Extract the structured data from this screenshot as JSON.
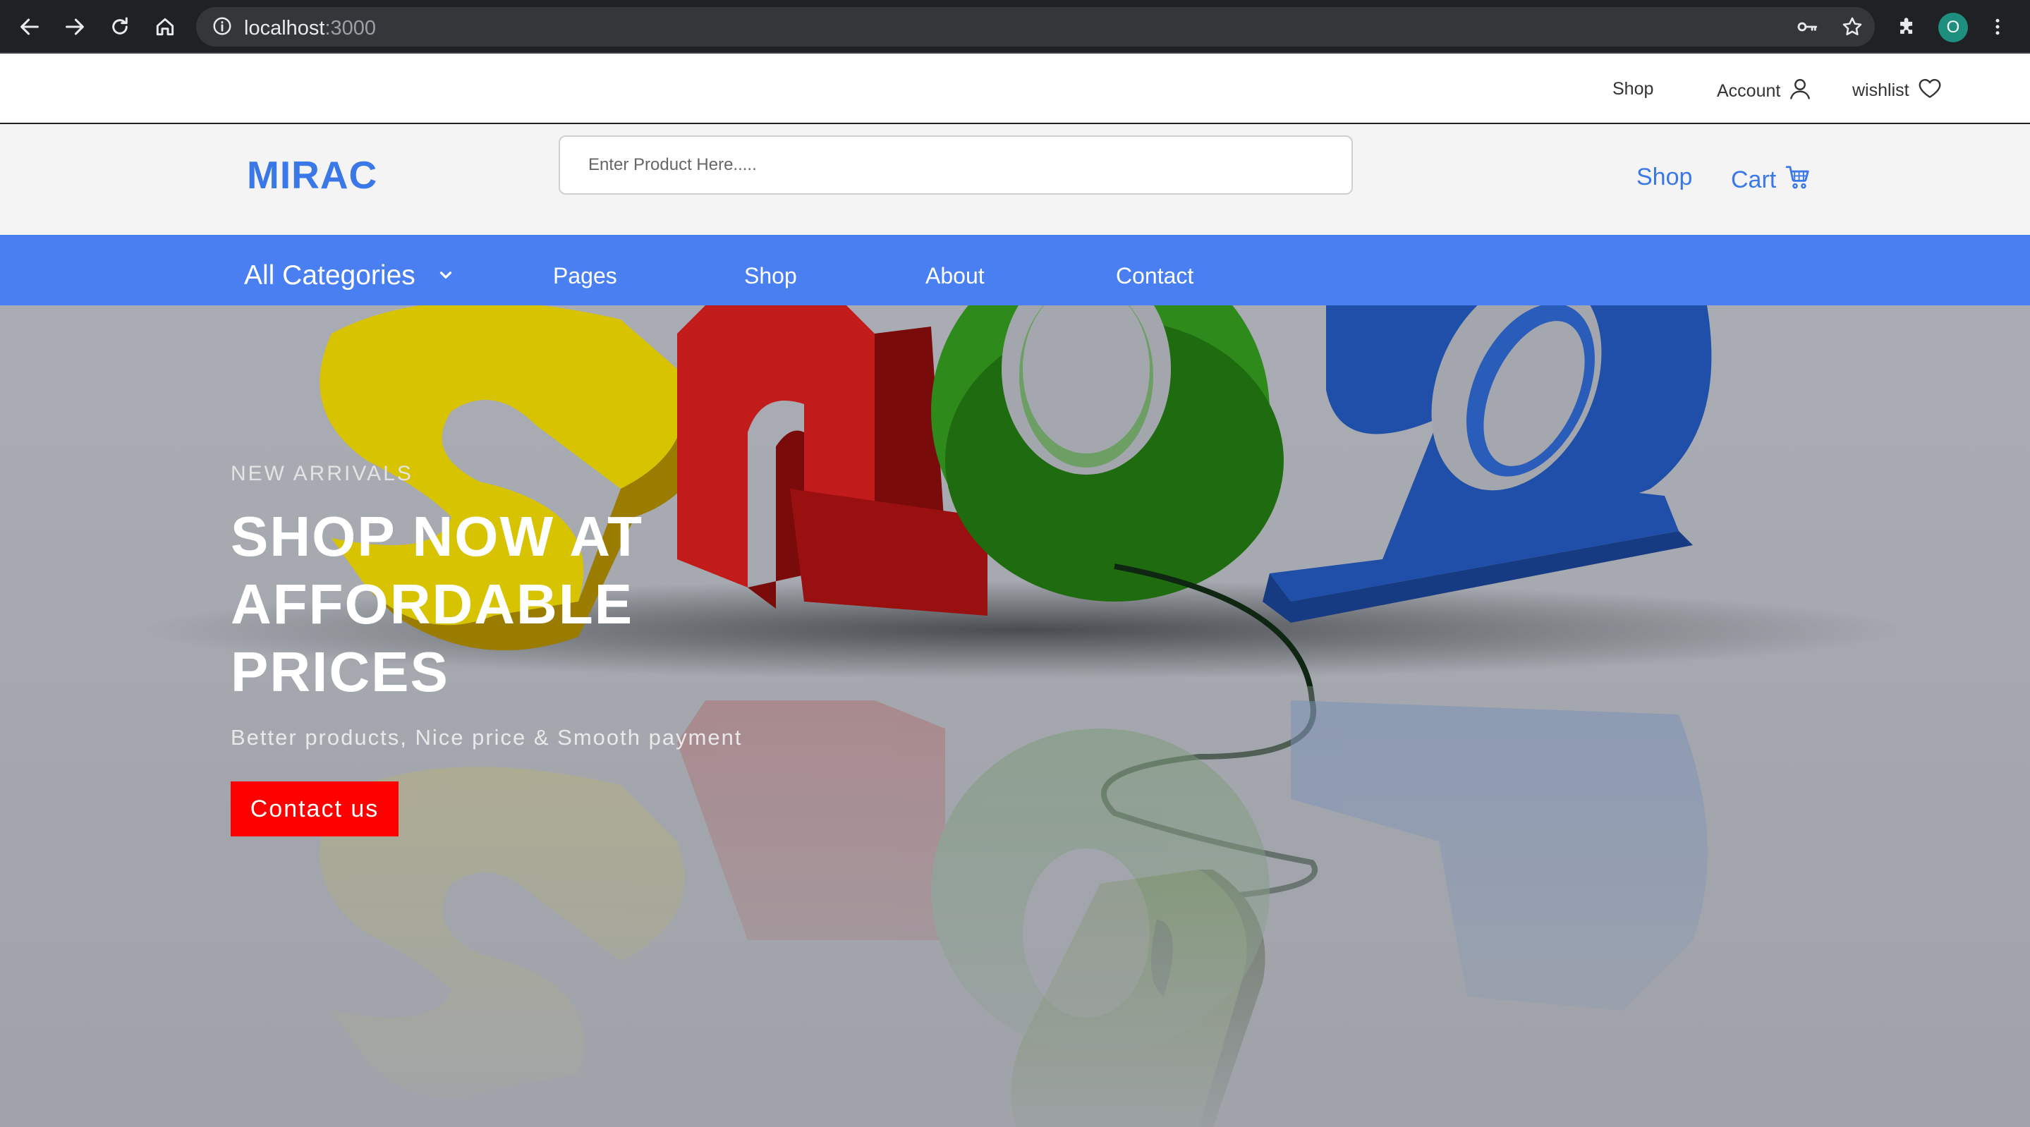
{
  "browser": {
    "url_host": "localhost",
    "url_port": ":3000",
    "profile_initial": "O",
    "icons": [
      "back-arrow-icon",
      "forward-arrow-icon",
      "reload-icon",
      "home-icon",
      "info-icon",
      "key-icon",
      "star-icon",
      "puzzle-icon",
      "more-vert-icon"
    ]
  },
  "topbar": {
    "shop": "Shop",
    "account": "Account",
    "wishlist": "wishlist"
  },
  "header": {
    "logo": "MIRAC",
    "search_placeholder": "Enter Product Here.....",
    "shop": "Shop",
    "cart": "Cart"
  },
  "nav": {
    "categories": "All Categories",
    "pages": "Pages",
    "shop": "Shop",
    "about": "About",
    "contact": "Contact"
  },
  "hero": {
    "kicker": "NEW ARRIVALS",
    "headline": "SHOP NOW AT AFFORDABLE PRICES",
    "subtitle": "Better products, Nice price & Smooth payment",
    "cta": "Contact us"
  },
  "colors": {
    "brand_blue": "#3b78e7",
    "nav_blue": "#4a7ff2",
    "cta_red": "#ff0000"
  }
}
